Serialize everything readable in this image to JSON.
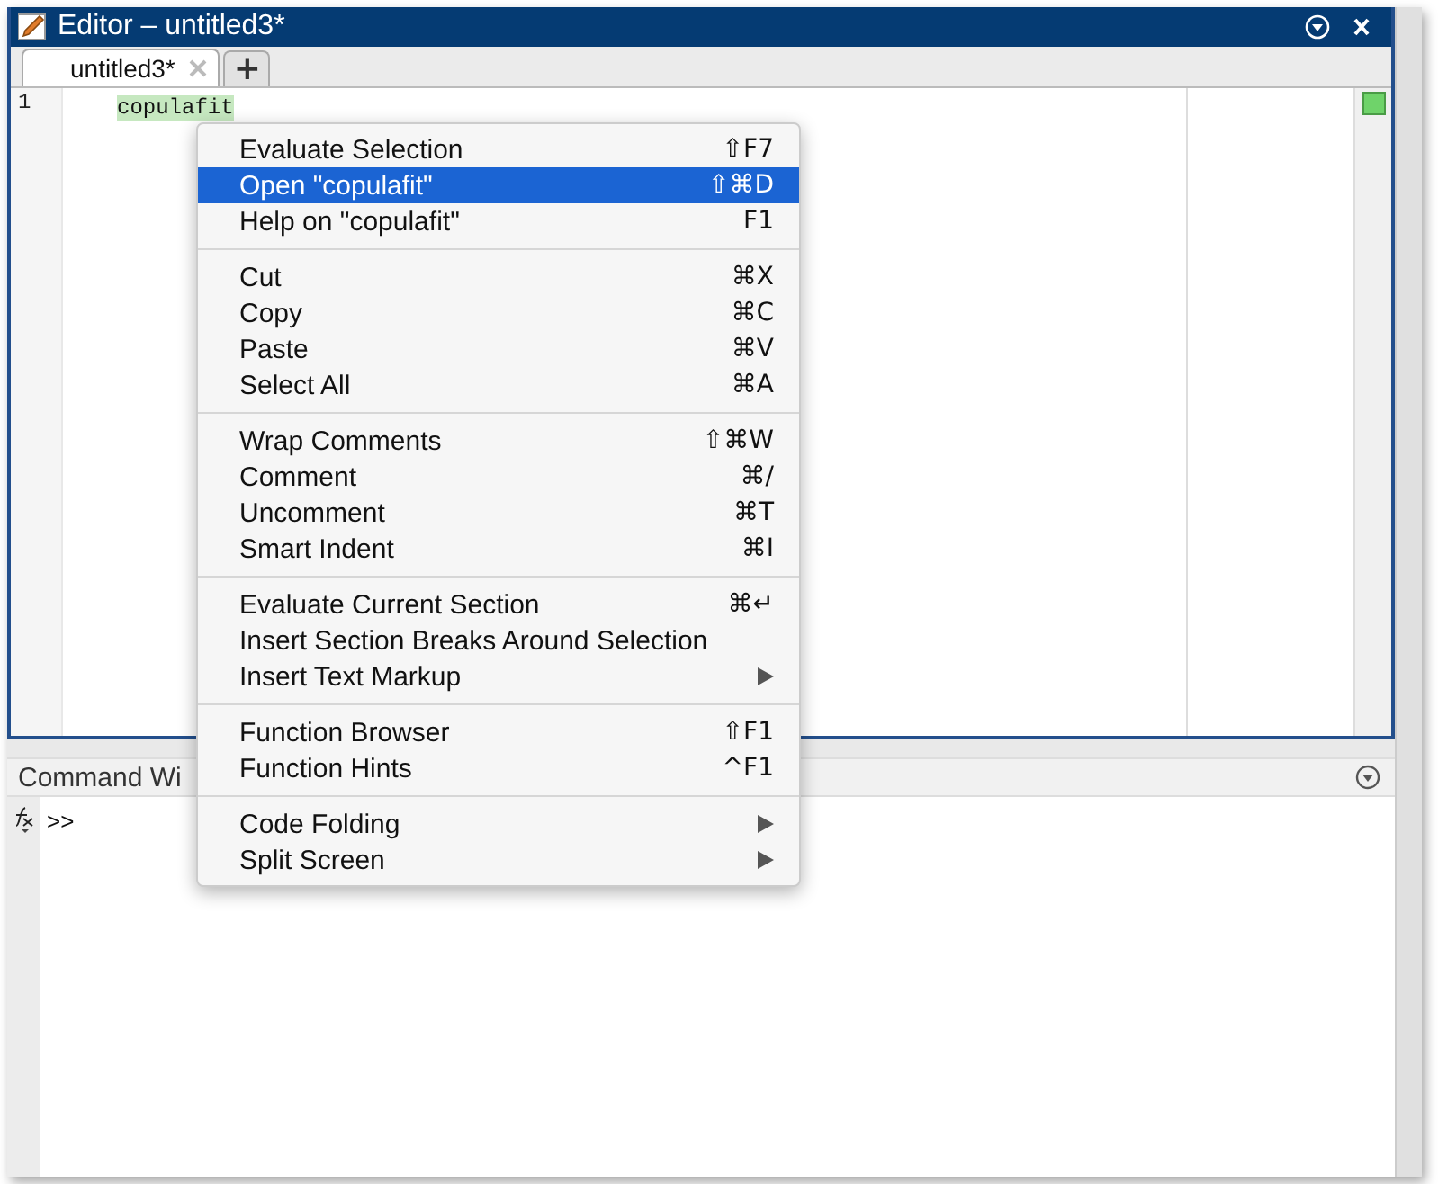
{
  "editor": {
    "title": "Editor – untitled3*",
    "tabs": [
      {
        "label": "untitled3*",
        "selected": true
      }
    ],
    "add_tab": "+",
    "lines": [
      {
        "number": "1",
        "code": "copulafit",
        "highlighted": true
      }
    ]
  },
  "command_window": {
    "title": "Command Wi",
    "prompt": ">>"
  },
  "context_menu": {
    "groups": [
      [
        {
          "label": "Evaluate Selection",
          "shortcut": "⇧F7",
          "kind": "item",
          "selected": false
        },
        {
          "label": "Open \"copulafit\"",
          "shortcut": "⇧⌘D",
          "kind": "item",
          "selected": true
        },
        {
          "label": "Help on \"copulafit\"",
          "shortcut": "F1",
          "kind": "item",
          "selected": false
        }
      ],
      [
        {
          "label": "Cut",
          "shortcut": "⌘X",
          "kind": "item",
          "selected": false
        },
        {
          "label": "Copy",
          "shortcut": "⌘C",
          "kind": "item",
          "selected": false
        },
        {
          "label": "Paste",
          "shortcut": "⌘V",
          "kind": "item",
          "selected": false
        },
        {
          "label": "Select All",
          "shortcut": "⌘A",
          "kind": "item",
          "selected": false
        }
      ],
      [
        {
          "label": "Wrap Comments",
          "shortcut": "⇧⌘W",
          "kind": "item",
          "selected": false
        },
        {
          "label": "Comment",
          "shortcut": "⌘/",
          "kind": "item",
          "selected": false
        },
        {
          "label": "Uncomment",
          "shortcut": "⌘T",
          "kind": "item",
          "selected": false
        },
        {
          "label": "Smart Indent",
          "shortcut": "⌘I",
          "kind": "item",
          "selected": false
        }
      ],
      [
        {
          "label": "Evaluate Current Section",
          "shortcut": "⌘↵",
          "kind": "item",
          "selected": false
        },
        {
          "label": "Insert Section Breaks Around Selection",
          "kind": "item",
          "selected": false
        },
        {
          "label": "Insert Text Markup",
          "kind": "submenu",
          "selected": false
        }
      ],
      [
        {
          "label": "Function Browser",
          "shortcut": "⇧F1",
          "kind": "item",
          "selected": false
        },
        {
          "label": "Function Hints",
          "shortcut": "^F1",
          "kind": "item",
          "selected": false
        }
      ],
      [
        {
          "label": "Code Folding",
          "kind": "submenu",
          "selected": false
        },
        {
          "label": "Split Screen",
          "kind": "submenu",
          "selected": false
        }
      ]
    ]
  }
}
